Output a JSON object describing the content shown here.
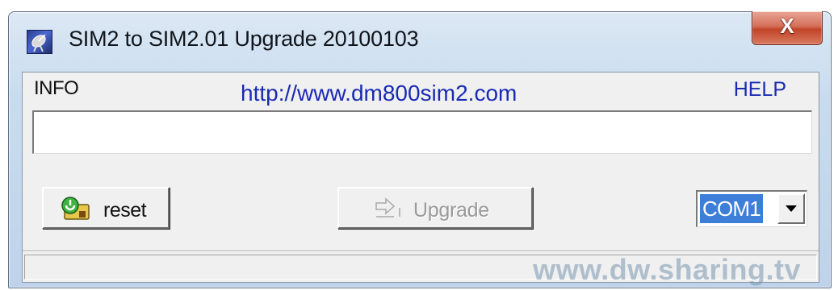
{
  "window": {
    "title": "SIM2 to SIM2.01 Upgrade 20100103",
    "icon": "satellite-dish-icon",
    "close_glyph": "X"
  },
  "info": {
    "label": "INFO",
    "link": "http://www.dm800sim2.com",
    "help": "HELP",
    "field_value": ""
  },
  "buttons": {
    "reset_label": "reset",
    "upgrade_label": "Upgrade",
    "upgrade_enabled": false
  },
  "port": {
    "selected": "COM1"
  },
  "status": {
    "text": ""
  },
  "watermark": "www.dw.sharing.tv",
  "colors": {
    "link": "#1a2bb3",
    "close_button": "#c2442a",
    "selection": "#3d7ed8",
    "disabled_text": "#9a9a9a"
  }
}
